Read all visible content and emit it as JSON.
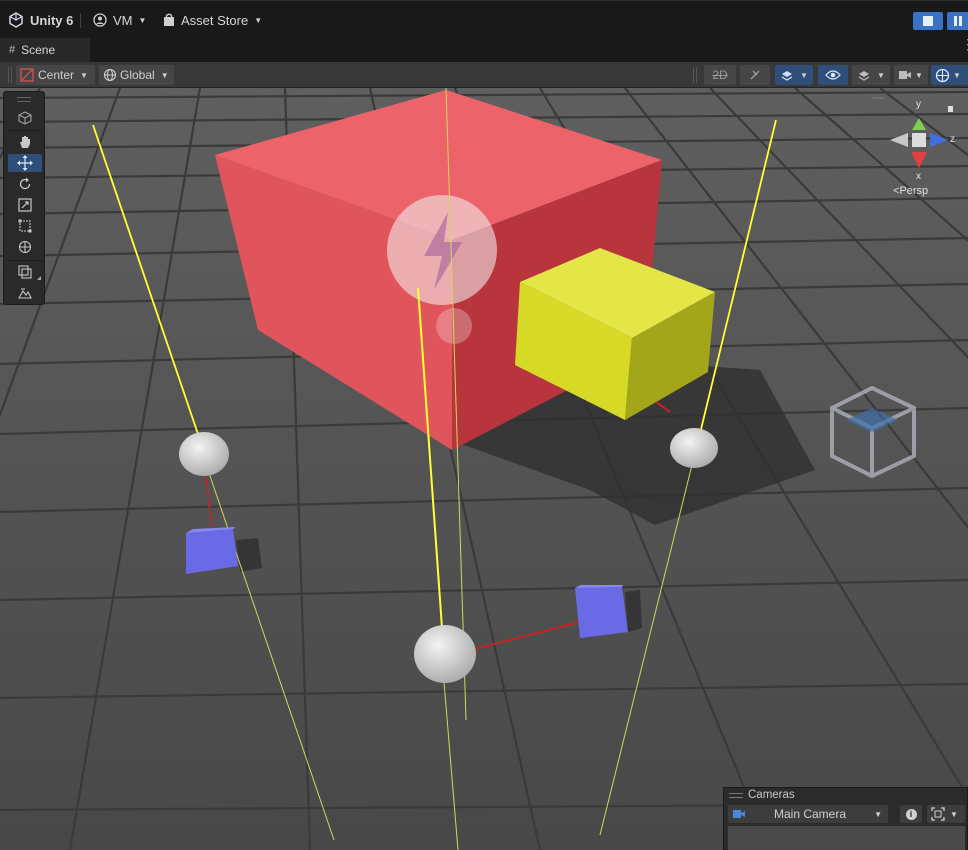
{
  "menubar": {
    "app_title": "Unity 6",
    "account": "VM",
    "asset_store": "Asset Store"
  },
  "scene_tab": {
    "label": "Scene"
  },
  "scene_toolbar": {
    "pivot_mode": "Center",
    "pivot_rotation": "Global"
  },
  "gizmo": {
    "axes": {
      "y": "y",
      "z": "z",
      "x": "x"
    },
    "projection": "Persp"
  },
  "tools": [
    "view-tool",
    "hand-tool",
    "move-tool",
    "rotate-tool",
    "scale-tool",
    "rect-tool",
    "transform-tool",
    "custom-tool",
    "terrain-tool"
  ],
  "cameras_overlay": {
    "title": "Cameras",
    "selected_camera": "Main Camera"
  },
  "colors": {
    "accent": "#3a72c4",
    "red_cube": "#e85a5e",
    "yellow_cube": "#d8dc2c",
    "blue_cube": "#6a6ae6",
    "light_line": "#ffff33"
  }
}
